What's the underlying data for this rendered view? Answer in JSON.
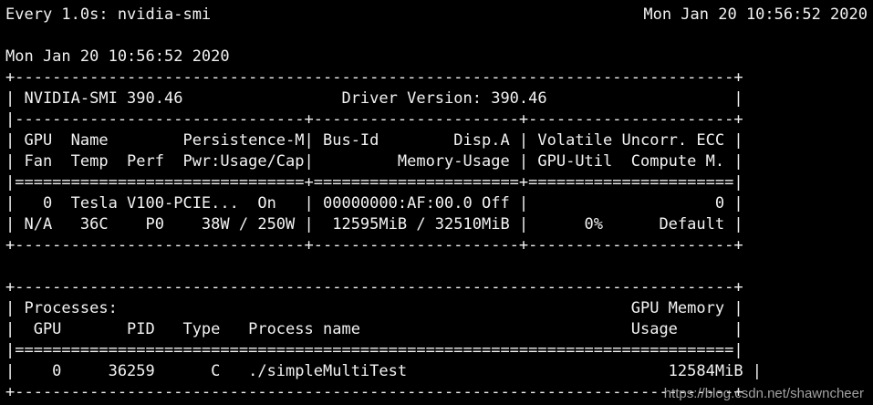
{
  "watch": {
    "command": "Every 1.0s: nvidia-smi",
    "time": "Mon Jan 20 10:56:52 2020"
  },
  "output": {
    "timestamp": "Mon Jan 20 10:56:52 2020",
    "border": "+-----------------------------------------------------------------------------+",
    "version_line": "| NVIDIA-SMI 390.46                 Driver Version: 390.46                    |",
    "sep_dash": "|-------------------------------+----------------------+----------------------+",
    "gpu_header_1": "| GPU  Name        Persistence-M| Bus-Id        Disp.A | Volatile Uncorr. ECC |",
    "gpu_header_2": "| Fan  Temp  Perf  Pwr:Usage/Cap|         Memory-Usage | GPU-Util  Compute M. |",
    "sep_double": "|===============================+======================+======================|",
    "gpu_row_1": "|   0  Tesla V100-PCIE...  On   | 00000000:AF:00.0 Off |                    0 |",
    "gpu_row_2": "| N/A   36C    P0    38W / 250W |  12595MiB / 32510MiB |      0%      Default |",
    "gpu_bottom": "+-------------------------------+----------------------+----------------------+",
    "proc_title": "| Processes:                                                       GPU Memory |",
    "proc_header": "|  GPU       PID   Type   Process name                             Usage      |",
    "proc_sep": "|=============================================================================|",
    "proc_row": "|    0     36259      C   ./simpleMultiTest                            12584MiB |"
  },
  "watermark": "https://blog.csdn.net/shawncheer"
}
